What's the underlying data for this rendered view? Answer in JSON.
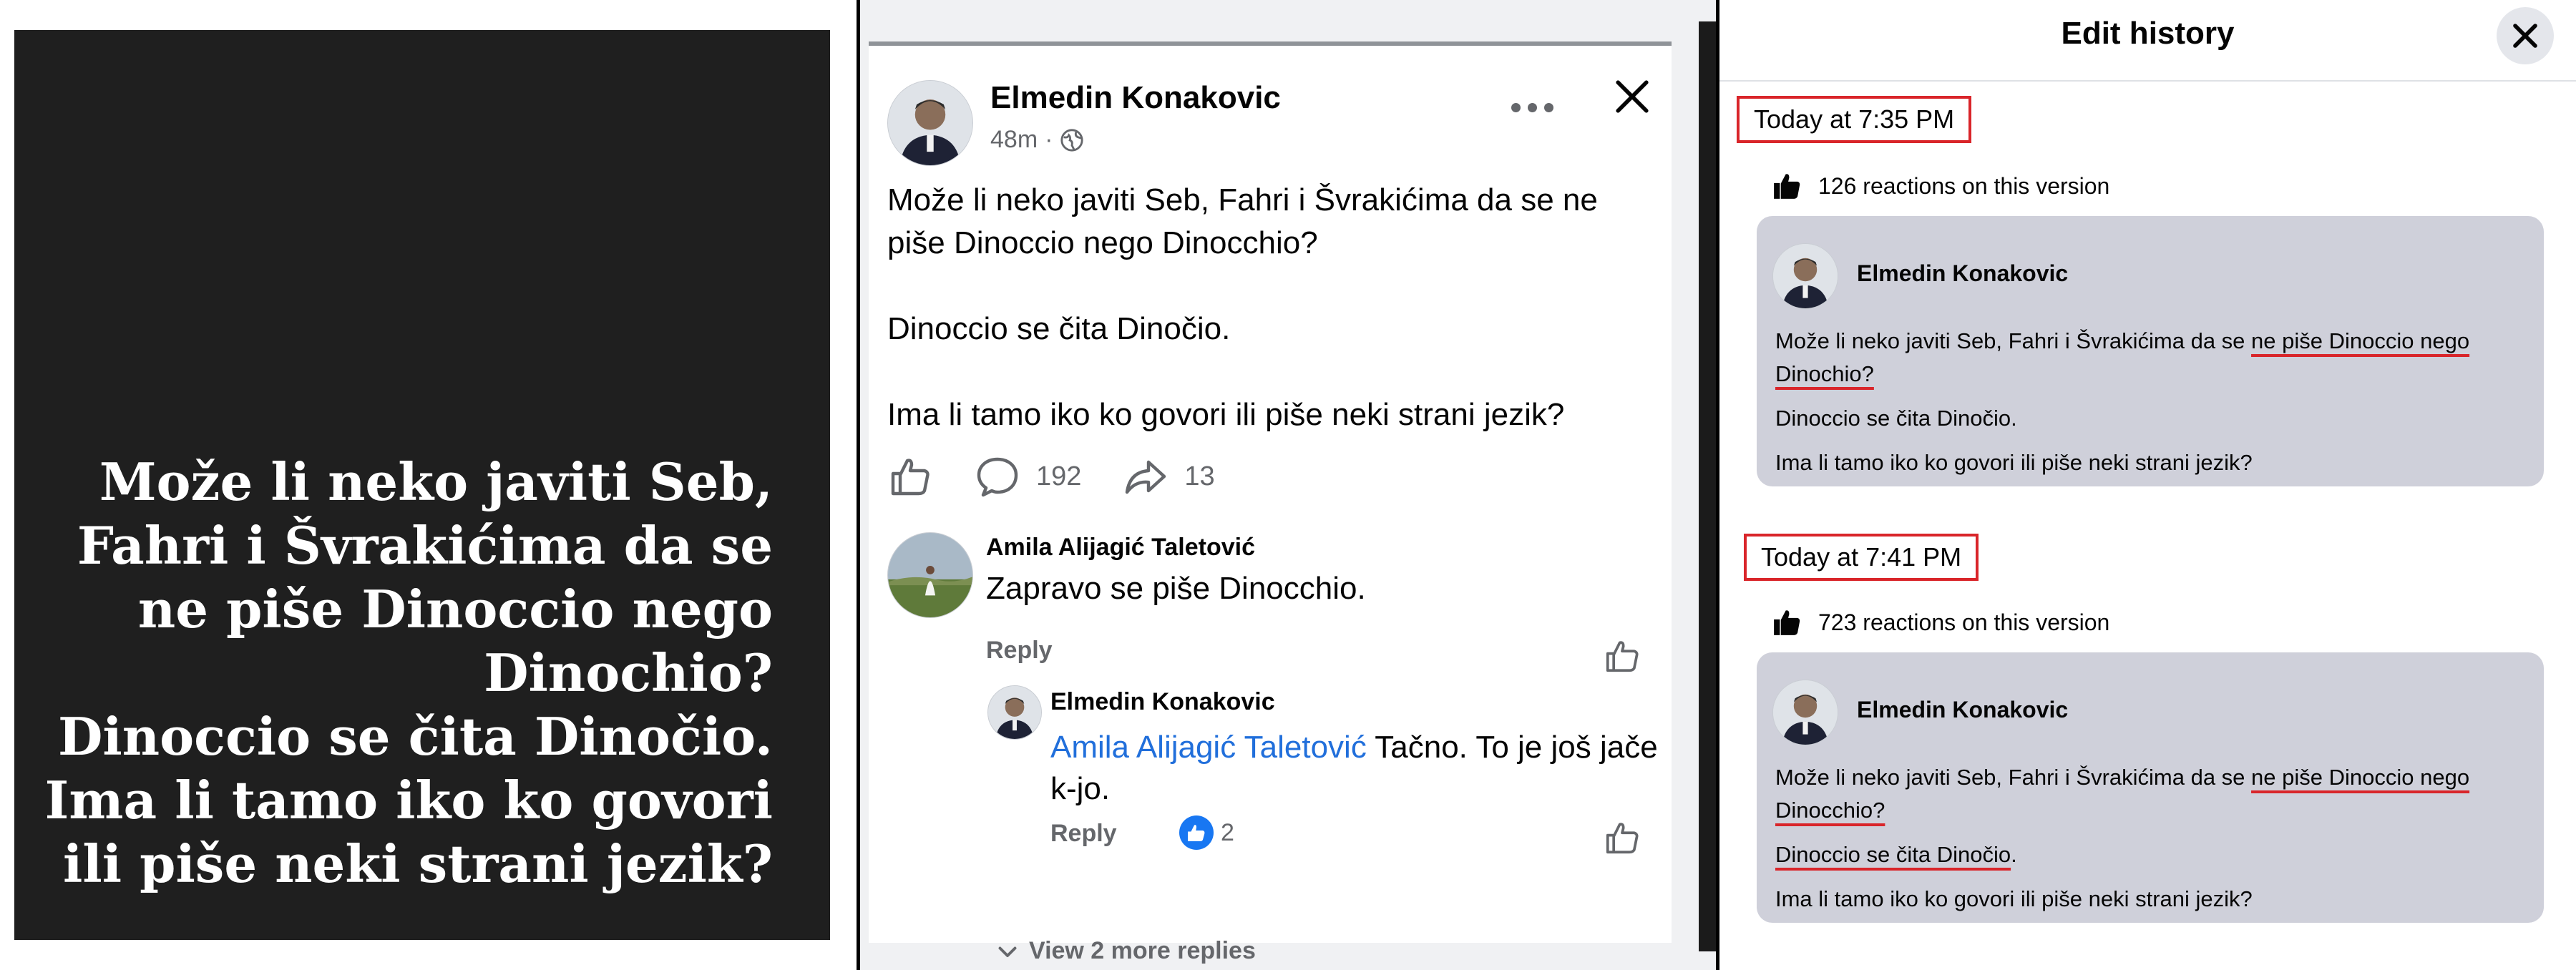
{
  "panel1": {
    "quote_lines": [
      "Može li neko javiti Seb,",
      "Fahri i Švrakićima da se",
      "ne piše Dinoccio nego",
      "Dinochio?",
      "Dinoccio se čita Dinočio.",
      "Ima li tamo iko ko govori",
      "ili piše neki strani jezik?"
    ]
  },
  "post": {
    "author": "Elmedin Konakovic",
    "time": "48m",
    "separator": "·",
    "privacy_icon": "globe-icon",
    "lines": [
      "Može li neko javiti Seb, Fahri i Švrakićima da se ne",
      "piše Dinoccio nego Dinocchio?",
      "Dinoccio se čita Dinočio.",
      "Ima li tamo iko ko govori ili piše neki strani jezik?"
    ],
    "comment_count": "192",
    "share_count": "13"
  },
  "comment": {
    "author": "Amila Alijagić Taletović",
    "text": "Zapravo se piše Dinocchio.",
    "reply_label": "Reply"
  },
  "reply": {
    "author": "Elmedin Konakovic",
    "mention": "Amila Alijagić Taletović",
    "text": " Tačno. To je još jače k-jo.",
    "reply_label": "Reply",
    "reaction_count": "2",
    "more_replies": "View 2 more replies"
  },
  "edit_history": {
    "title": "Edit history",
    "versions": [
      {
        "timestamp": "Today at 7:35 PM",
        "reactions": "126 reactions on this version",
        "author": "Elmedin Konakovic",
        "line1_plain": "Može li neko javiti Seb, Fahri i Švrakićima da se ",
        "line1_highlight": "ne piše Dinoccio nego",
        "line2_highlight": "Dinochio?",
        "line2_plain": "",
        "para2_highlight": "",
        "para2_plain": "Dinoccio se čita Dinočio.",
        "para3": "Ima li tamo iko ko govori ili piše neki strani jezik?"
      },
      {
        "timestamp": "Today at 7:41 PM",
        "reactions": "723 reactions on this version",
        "author": "Elmedin Konakovic",
        "line1_plain": "Može li neko javiti Seb, Fahri i Švrakićima da se ",
        "line1_highlight": "ne piše Dinoccio nego",
        "line2_highlight": "Dinocchio?",
        "line2_plain": "",
        "para2_highlight": "Dinoccio se čita Dinočio",
        "para2_plain": ".",
        "para3": "Ima li tamo iko ko govori ili piše neki strani jezik?"
      }
    ]
  },
  "colors": {
    "accent_red": "#d9252a",
    "link_blue": "#216fdb",
    "card_gray": "#cfd0da",
    "quote_bg": "#1f1f1f"
  }
}
